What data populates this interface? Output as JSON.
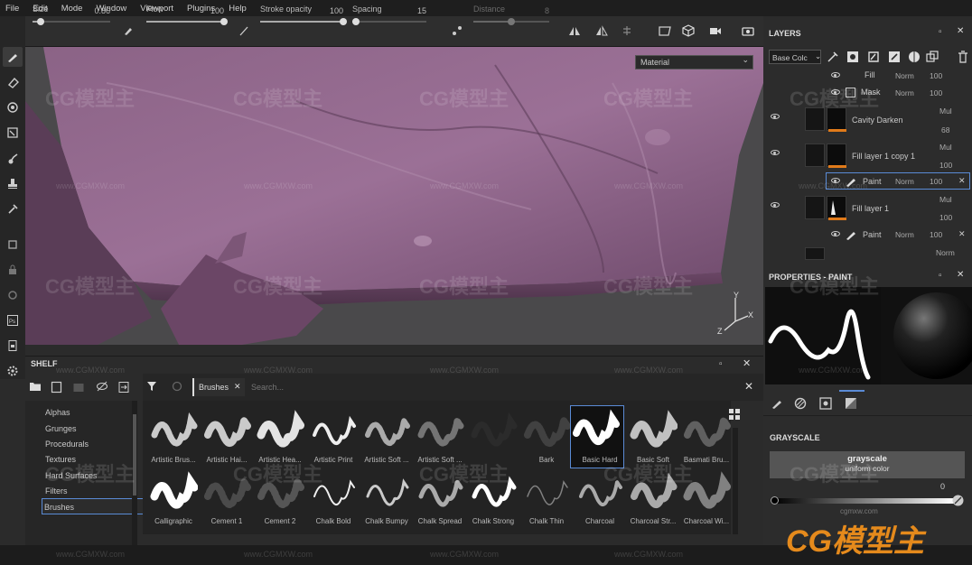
{
  "menu": [
    "File",
    "Edit",
    "Mode",
    "Window",
    "Viewport",
    "Plugins",
    "Help"
  ],
  "toolbar": {
    "size_label": "Size",
    "size_value": "0.86",
    "size_level": 0.1,
    "flow_label": "Flow",
    "flow_value": "100",
    "flow_level": 1.0,
    "stroke_label": "Stroke opacity",
    "stroke_value": "100",
    "stroke_level": 1.0,
    "spacing_label": "Spacing",
    "spacing_value": "15",
    "spacing_level": 0.05,
    "distance_label": "Distance",
    "distance_value": "8",
    "distance_level": 0.5
  },
  "viewport": {
    "material_select": "Material",
    "axis_y": "Y",
    "axis_x": "X",
    "axis_z": "Z"
  },
  "shelf": {
    "title": "SHELF",
    "filter_tag": "Brushes",
    "search_placeholder": "Search...",
    "categories": [
      "Alphas",
      "Grunges",
      "Procedurals",
      "Textures",
      "Hard Surfaces",
      "Filters",
      "Brushes"
    ],
    "selected_category": "Brushes",
    "brushes_row1": [
      "Artistic Brus...",
      "Artistic Hai...",
      "Artistic Hea...",
      "Artistic Print",
      "Artistic Soft ...",
      "Artistic Soft ...",
      "",
      "Bark",
      "Basic Hard",
      "Basic Soft",
      "Basmati Bru..."
    ],
    "brushes_row2": [
      "Calligraphic",
      "Cement 1",
      "Cement 2",
      "Chalk Bold",
      "Chalk Bumpy",
      "Chalk Spread",
      "Chalk Strong",
      "Chalk Thin",
      "Charcoal",
      "Charcoal Str...",
      "Charcoal Wi..."
    ],
    "selected_brush": "Basic Hard"
  },
  "layers": {
    "title": "LAYERS",
    "channel_select": "Base Colc",
    "rows": [
      {
        "name": "Fill",
        "blend": "Norm",
        "opacity": "100"
      },
      {
        "name": "Mask",
        "blend": "Norm",
        "opacity": "100"
      },
      {
        "name": "Cavity Darken",
        "blend": "Mul",
        "opacity": "68"
      },
      {
        "name": "Fill layer 1 copy 1",
        "blend": "Mul",
        "opacity": "100"
      },
      {
        "name": "Paint",
        "blend": "Norm",
        "opacity": "100"
      },
      {
        "name": "Fill layer 1",
        "blend": "Mul",
        "opacity": "100"
      },
      {
        "name": "Paint",
        "blend": "Norm",
        "opacity": "100"
      },
      {
        "name": "",
        "blend": "Norm",
        "opacity": ""
      }
    ]
  },
  "properties": {
    "title": "PROPERTIES - PAINT",
    "section": "GRAYSCALE",
    "grayscale_title": "grayscale",
    "grayscale_sub": "uniform color",
    "value": "0",
    "value_level": 0.0
  },
  "watermarks": {
    "logo": "CG模型主",
    "url": "www.CGMXW.com",
    "corner_url": "cgmxw.com"
  },
  "colors": {
    "accent": "#5a8bd6",
    "orange": "#e07a1a",
    "fabric": "#8a5e80"
  }
}
